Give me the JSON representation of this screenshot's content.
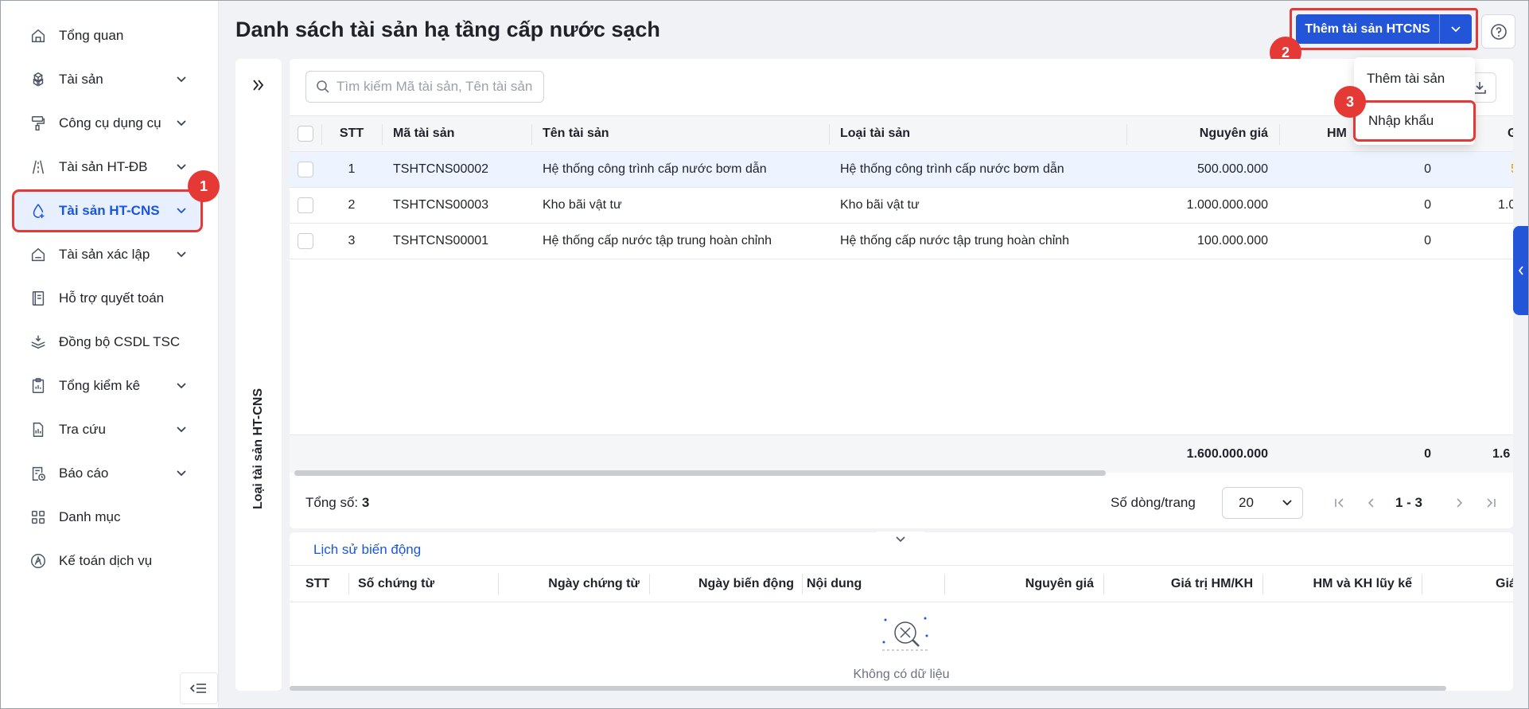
{
  "sidebar": {
    "items": [
      {
        "label": "Tổng quan",
        "icon": "home-icon",
        "has_children": false
      },
      {
        "label": "Tài sản",
        "icon": "cubes-icon",
        "has_children": true
      },
      {
        "label": "Công cụ dụng cụ",
        "icon": "paint-roller-icon",
        "has_children": true
      },
      {
        "label": "Tài sản HT-ĐB",
        "icon": "road-icon",
        "has_children": true
      },
      {
        "label": "Tài sản HT-CNS",
        "icon": "water-drop-icon",
        "has_children": true,
        "active": true
      },
      {
        "label": "Tài sản xác lập",
        "icon": "house-icon",
        "has_children": true
      },
      {
        "label": "Hỗ trợ quyết toán",
        "icon": "book-icon",
        "has_children": false
      },
      {
        "label": "Đồng bộ CSDL TSC",
        "icon": "layers-sync-icon",
        "has_children": false
      },
      {
        "label": "Tổng kiểm kê",
        "icon": "clipboard-icon",
        "has_children": true
      },
      {
        "label": "Tra cứu",
        "icon": "file-chart-icon",
        "has_children": true
      },
      {
        "label": "Báo cáo",
        "icon": "report-clock-icon",
        "has_children": true
      },
      {
        "label": "Danh mục",
        "icon": "grid-icon",
        "has_children": false
      },
      {
        "label": "Kế toán dịch vụ",
        "icon": "accounting-logo-icon",
        "has_children": false
      }
    ]
  },
  "header": {
    "title": "Danh sách tài sản hạ tầng cấp nước sạch",
    "add_button": "Thêm tài sản HTCNS"
  },
  "dropdown": {
    "items": [
      "Thêm tài sản",
      "Nhập khẩu"
    ]
  },
  "badges": [
    "1",
    "2",
    "3"
  ],
  "left_panel": {
    "vertical_label": "Loại tài sản HT-CNS"
  },
  "search": {
    "placeholder": "Tìm kiếm Mã tài sản, Tên tài sản",
    "value": ""
  },
  "table": {
    "columns": [
      "STT",
      "Mã tài sản",
      "Tên tài sản",
      "Loại tài sản",
      "Nguyên giá",
      "HM",
      "G"
    ],
    "rows": [
      {
        "stt": "1",
        "code": "TSHTCNS00002",
        "name": "Hệ thống công trình cấp nước bơm dẫn",
        "type": "Hệ thống công trình cấp nước bơm dẫn",
        "price": "500.000.000",
        "hm": "0",
        "extra": "5"
      },
      {
        "stt": "2",
        "code": "TSHTCNS00003",
        "name": "Kho bãi vật tư",
        "type": "Kho bãi vật tư",
        "price": "1.000.000.000",
        "hm": "0",
        "extra": "1.0"
      },
      {
        "stt": "3",
        "code": "TSHTCNS00001",
        "name": "Hệ thống cấp nước tập trung hoàn chỉnh",
        "type": "Hệ thống cấp nước tập trung hoàn chỉnh",
        "price": "100.000.000",
        "hm": "0",
        "extra": ""
      }
    ],
    "footer": {
      "price": "1.600.000.000",
      "hm": "0",
      "extra": "1.6"
    }
  },
  "pager": {
    "total_label": "Tổng số:",
    "total": "3",
    "rows_label": "Số dòng/trang",
    "rows_per_page": "20",
    "range": "1 - 3"
  },
  "history": {
    "tab": "Lịch sử biến động",
    "columns": [
      "STT",
      "Số chứng từ",
      "Ngày chứng từ",
      "Ngày biến động",
      "Nội dung",
      "Nguyên giá",
      "Giá trị HM/KH",
      "HM và KH lũy kế",
      "Giá"
    ],
    "empty": "Không có dữ liệu"
  },
  "colors": {
    "accent": "#2255d8",
    "highlight": "#e53935",
    "active_bg": "#e8f0ff"
  }
}
